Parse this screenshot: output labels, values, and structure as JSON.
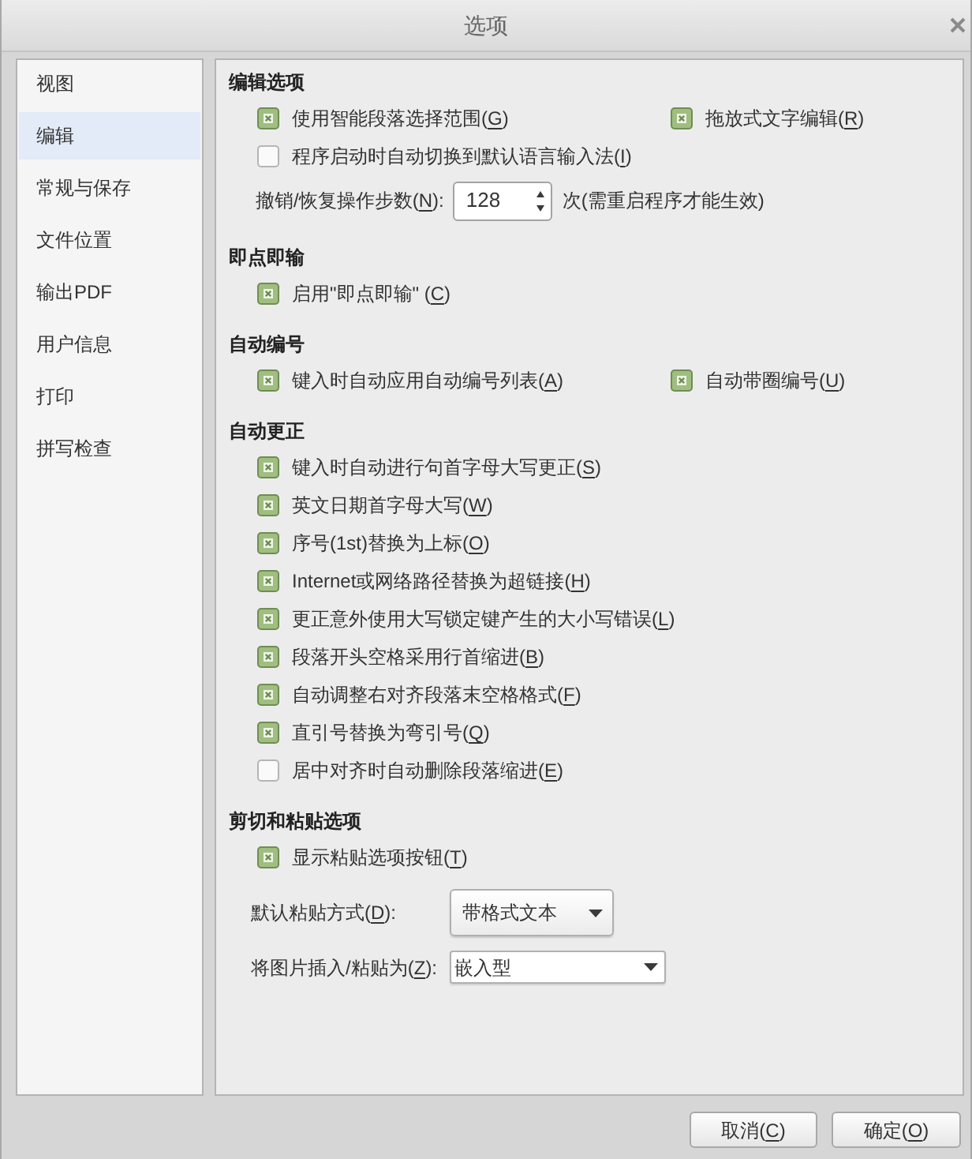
{
  "window": {
    "title": "选项"
  },
  "sidebar": {
    "items": [
      {
        "label": "视图",
        "selected": false
      },
      {
        "label": "编辑",
        "selected": true
      },
      {
        "label": "常规与保存",
        "selected": false
      },
      {
        "label": "文件位置",
        "selected": false
      },
      {
        "label": "输出PDF",
        "selected": false
      },
      {
        "label": "用户信息",
        "selected": false
      },
      {
        "label": "打印",
        "selected": false
      },
      {
        "label": "拼写检查",
        "selected": false
      }
    ]
  },
  "sections": [
    {
      "title": "编辑选项",
      "rows": [
        {
          "kind": "checkboxes",
          "items": [
            {
              "label": "使用智能段落选择范围(",
              "access_key": "G",
              "label_end": ")",
              "checked": true
            },
            {
              "label": "拖放式文字编辑(",
              "access_key": "R",
              "label_end": ")",
              "checked": true
            }
          ]
        },
        {
          "kind": "checkboxes",
          "items": [
            {
              "label": "程序启动时自动切换到默认语言输入法(",
              "access_key": "I",
              "label_end": ")",
              "checked": false
            }
          ]
        },
        {
          "kind": "spinner",
          "label": "撤销/恢复操作步数(",
          "access_key": "N",
          "label_end": "):",
          "value": "128",
          "suffix": "次(需重启程序才能生效)"
        }
      ]
    },
    {
      "title": "即点即输",
      "rows": [
        {
          "kind": "checkboxes",
          "items": [
            {
              "label": "启用\"即点即输\" (",
              "access_key": "C",
              "label_end": ")",
              "checked": true
            }
          ]
        }
      ]
    },
    {
      "title": "自动编号",
      "rows": [
        {
          "kind": "checkboxes",
          "items": [
            {
              "label": "键入时自动应用自动编号列表(",
              "access_key": "A",
              "label_end": ")",
              "checked": true
            },
            {
              "label": "自动带圈编号(",
              "access_key": "U",
              "label_end": ")",
              "checked": true
            }
          ]
        }
      ]
    },
    {
      "title": "自动更正",
      "rows": [
        {
          "kind": "checkboxes",
          "items": [
            {
              "label": "键入时自动进行句首字母大写更正(",
              "access_key": "S",
              "label_end": ")",
              "checked": true
            }
          ]
        },
        {
          "kind": "checkboxes",
          "items": [
            {
              "label": "英文日期首字母大写(",
              "access_key": "W",
              "label_end": ")",
              "checked": true
            }
          ]
        },
        {
          "kind": "checkboxes",
          "items": [
            {
              "label": "序号(1st)替换为上标(",
              "access_key": "O",
              "label_end": ")",
              "checked": true
            }
          ]
        },
        {
          "kind": "checkboxes",
          "items": [
            {
              "label": "Internet或网络路径替换为超链接(",
              "access_key": "H",
              "label_end": ")",
              "checked": true
            }
          ]
        },
        {
          "kind": "checkboxes",
          "items": [
            {
              "label": "更正意外使用大写锁定键产生的大小写错误(",
              "access_key": "L",
              "label_end": ")",
              "checked": true
            }
          ]
        },
        {
          "kind": "checkboxes",
          "items": [
            {
              "label": "段落开头空格采用行首缩进(",
              "access_key": "B",
              "label_end": ")",
              "checked": true
            }
          ]
        },
        {
          "kind": "checkboxes",
          "items": [
            {
              "label": "自动调整右对齐段落末空格格式(",
              "access_key": "F",
              "label_end": ")",
              "checked": true
            }
          ]
        },
        {
          "kind": "checkboxes",
          "items": [
            {
              "label": "直引号替换为弯引号(",
              "access_key": "Q",
              "label_end": ")",
              "checked": true
            }
          ]
        },
        {
          "kind": "checkboxes",
          "items": [
            {
              "label": "居中对齐时自动删除段落缩进(",
              "access_key": "E",
              "label_end": ")",
              "checked": false
            }
          ]
        }
      ]
    },
    {
      "title": "剪切和粘贴选项",
      "rows": [
        {
          "kind": "checkboxes",
          "items": [
            {
              "label": "显示粘贴选项按钮(",
              "access_key": "T",
              "label_end": ")",
              "checked": true
            }
          ]
        },
        {
          "kind": "button_dropdown",
          "label": "默认粘贴方式(",
          "access_key": "D",
          "label_end": "):",
          "value": "带格式文本"
        },
        {
          "kind": "dropdown",
          "label": "将图片插入/粘贴为(",
          "access_key": "Z",
          "label_end": "):",
          "value": "嵌入型"
        }
      ]
    }
  ],
  "buttons": [
    {
      "label": "取消(",
      "access_key": "C",
      "label_end": ")"
    },
    {
      "label": "确定(",
      "access_key": "O",
      "label_end": ")"
    }
  ]
}
